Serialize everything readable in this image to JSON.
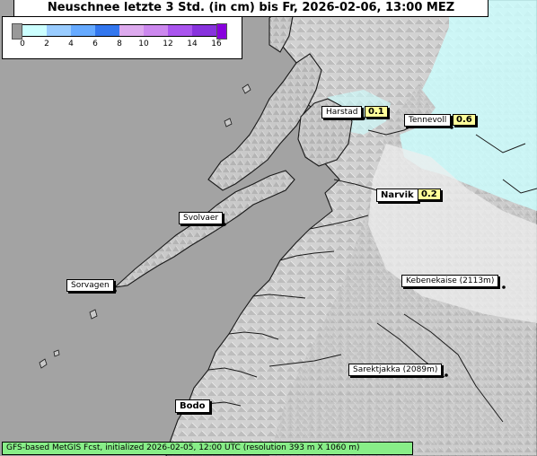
{
  "title": "Neuschnee letzte 3 Std. (in cm) bis Fr, 2026-02-06, 13:00 MEZ",
  "legend": {
    "ticks": [
      "0",
      "2",
      "4",
      "6",
      "8",
      "10",
      "12",
      "14",
      "16"
    ],
    "colors": [
      "#ccffff",
      "#99ccff",
      "#66aaff",
      "#3377ee",
      "#ddaaee",
      "#cc88ee",
      "#aa55ee",
      "#8833dd"
    ],
    "low_cap_color": "#999999",
    "high_cap_color": "#8800dd"
  },
  "places": [
    {
      "name": "Harstad",
      "value": "0.1"
    },
    {
      "name": "Tennevoll",
      "value": "0.6"
    },
    {
      "name": "Narvik",
      "value": "0.2"
    },
    {
      "name": "Svolvaer"
    },
    {
      "name": "Sorvagen"
    },
    {
      "name": "Kebenekaise (2113m)"
    },
    {
      "name": "Sarektjakka (2089m)"
    },
    {
      "name": "Bodo"
    }
  ],
  "footer": "GFS-based MetGIS Fcst, initialized 2026-02-05, 12:00 UTC  (resolution 393 m X 1060 m)",
  "colors": {
    "sea": "#a3a3a3",
    "land": "#c8c8c8",
    "snow_light": "#ccffff",
    "coastline": "#1a1a1a"
  }
}
